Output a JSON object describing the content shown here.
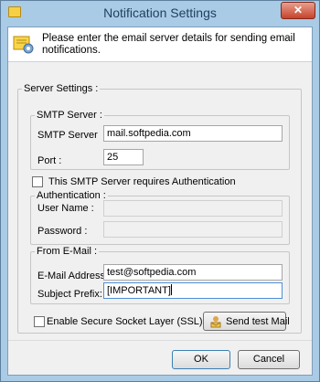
{
  "window": {
    "title": "Notification Settings",
    "close_glyph": "✕"
  },
  "header": {
    "instruction": "Please enter the email server details for sending email notifications."
  },
  "server_settings": {
    "legend": "Server Settings :"
  },
  "smtp": {
    "legend": "SMTP Server :",
    "server_label": "SMTP Server",
    "server_value": "mail.softpedia.com",
    "port_label": "Port :",
    "port_value": "25"
  },
  "auth_required": {
    "label": "This SMTP Server requires Authentication",
    "checked": false
  },
  "authentication": {
    "legend": "Authentication :",
    "username_label": "User Name :",
    "username_value": "",
    "password_label": "Password :",
    "password_value": ""
  },
  "from_email": {
    "legend": "From  E-Mail :",
    "address_label": "E-Mail Address :",
    "address_value": "test@softpedia.com",
    "subject_label": "Subject Prefix:",
    "subject_value": "[IMPORTANT]"
  },
  "ssl": {
    "label": "Enable Secure Socket Layer (SSL)",
    "checked": false
  },
  "buttons": {
    "send_test": "Send test Mail",
    "ok": "OK",
    "cancel": "Cancel"
  },
  "icons": {
    "app": "notification-app-icon",
    "header": "settings-note-icon",
    "send_test": "person-mail-icon",
    "close": "close-icon"
  }
}
